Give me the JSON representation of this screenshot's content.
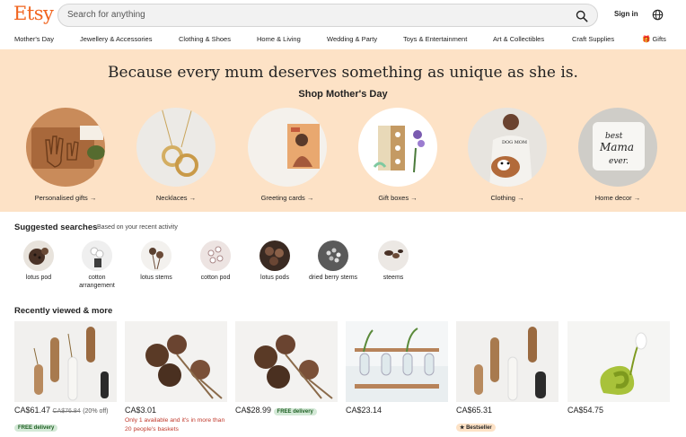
{
  "header": {
    "logo": "Etsy",
    "search_placeholder": "Search for anything",
    "sign_in": "Sign in"
  },
  "nav": [
    "Mother's Day",
    "Jewellery & Accessories",
    "Clothing & Shoes",
    "Home & Living",
    "Wedding & Party",
    "Toys & Entertainment",
    "Art & Collectibles",
    "Craft Supplies",
    "Gifts"
  ],
  "hero": {
    "title": "Because every mum deserves something as unique as she is.",
    "subtitle": "Shop Mother's Day",
    "categories": [
      {
        "label": "Personalised gifts",
        "arrow": "→"
      },
      {
        "label": "Necklaces",
        "arrow": "→"
      },
      {
        "label": "Greeting cards",
        "arrow": "→"
      },
      {
        "label": "Gift boxes",
        "arrow": "→"
      },
      {
        "label": "Clothing",
        "arrow": "→"
      },
      {
        "label": "Home decor",
        "arrow": "→"
      }
    ],
    "pillow_text": [
      "best",
      "Mama",
      "ever."
    ]
  },
  "suggested": {
    "title": "Suggested searches",
    "note": "Based on your recent activity",
    "items": [
      {
        "label": "lotus pod"
      },
      {
        "label": "cotton arrangement"
      },
      {
        "label": "lotus stems"
      },
      {
        "label": "cotton pod"
      },
      {
        "label": "lotus pods"
      },
      {
        "label": "dried berry stems"
      },
      {
        "label": "steems"
      }
    ]
  },
  "recent": {
    "title": "Recently viewed & more",
    "items": [
      {
        "price": "CA$61.47",
        "old_price": "CA$76.84",
        "discount": "(20% off)",
        "badge": "FREE delivery"
      },
      {
        "price": "CA$3.01",
        "stock_note": "Only 1 available and it's in more than 20 people's baskets"
      },
      {
        "price": "CA$28.99",
        "badge": "FREE delivery"
      },
      {
        "price": "CA$23.14"
      },
      {
        "price": "CA$65.31",
        "bestseller": "Bestseller"
      },
      {
        "price": "CA$54.75"
      }
    ]
  },
  "colors": {
    "brand": "#f1641e",
    "hero_bg": "#fde2c6",
    "badge_green": "#d4e9d7"
  }
}
